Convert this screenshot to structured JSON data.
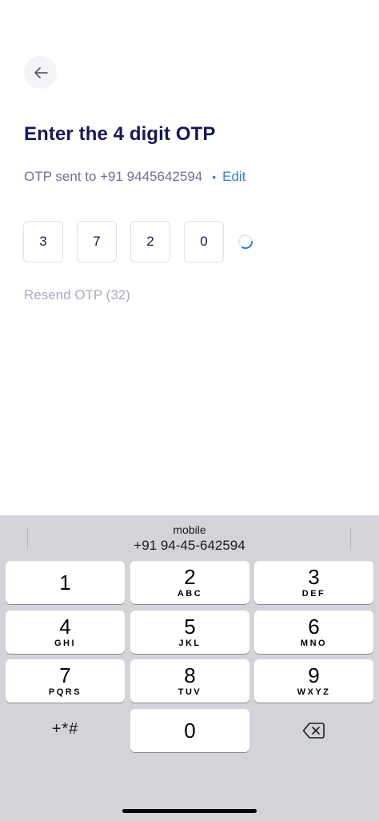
{
  "header": {
    "back_icon": "arrow-left-icon"
  },
  "title": "Enter the 4 digit OTP",
  "otp_info": {
    "sent_text": "OTP sent to +91 9445642594",
    "separator": "•",
    "edit_label": "Edit"
  },
  "otp": {
    "digits": [
      "3",
      "7",
      "2",
      "0"
    ],
    "loading_icon": "spinner-icon"
  },
  "resend_label": "Resend OTP (32)",
  "keyboard": {
    "suggestion_label": "mobile",
    "suggestion_value": "+91 94-45-642594",
    "keys": [
      {
        "num": "1",
        "letters": ""
      },
      {
        "num": "2",
        "letters": "ABC"
      },
      {
        "num": "3",
        "letters": "DEF"
      },
      {
        "num": "4",
        "letters": "GHI"
      },
      {
        "num": "5",
        "letters": "JKL"
      },
      {
        "num": "6",
        "letters": "MNO"
      },
      {
        "num": "7",
        "letters": "PQRS"
      },
      {
        "num": "8",
        "letters": "TUV"
      },
      {
        "num": "9",
        "letters": "WXYZ"
      }
    ],
    "symbols_label": "+*#",
    "zero": "0",
    "delete_icon": "backspace-icon"
  },
  "colors": {
    "title": "#15185a",
    "link": "#2f7fe0",
    "muted": "#a9abc0",
    "keyboard_bg": "#d2d4d9"
  }
}
